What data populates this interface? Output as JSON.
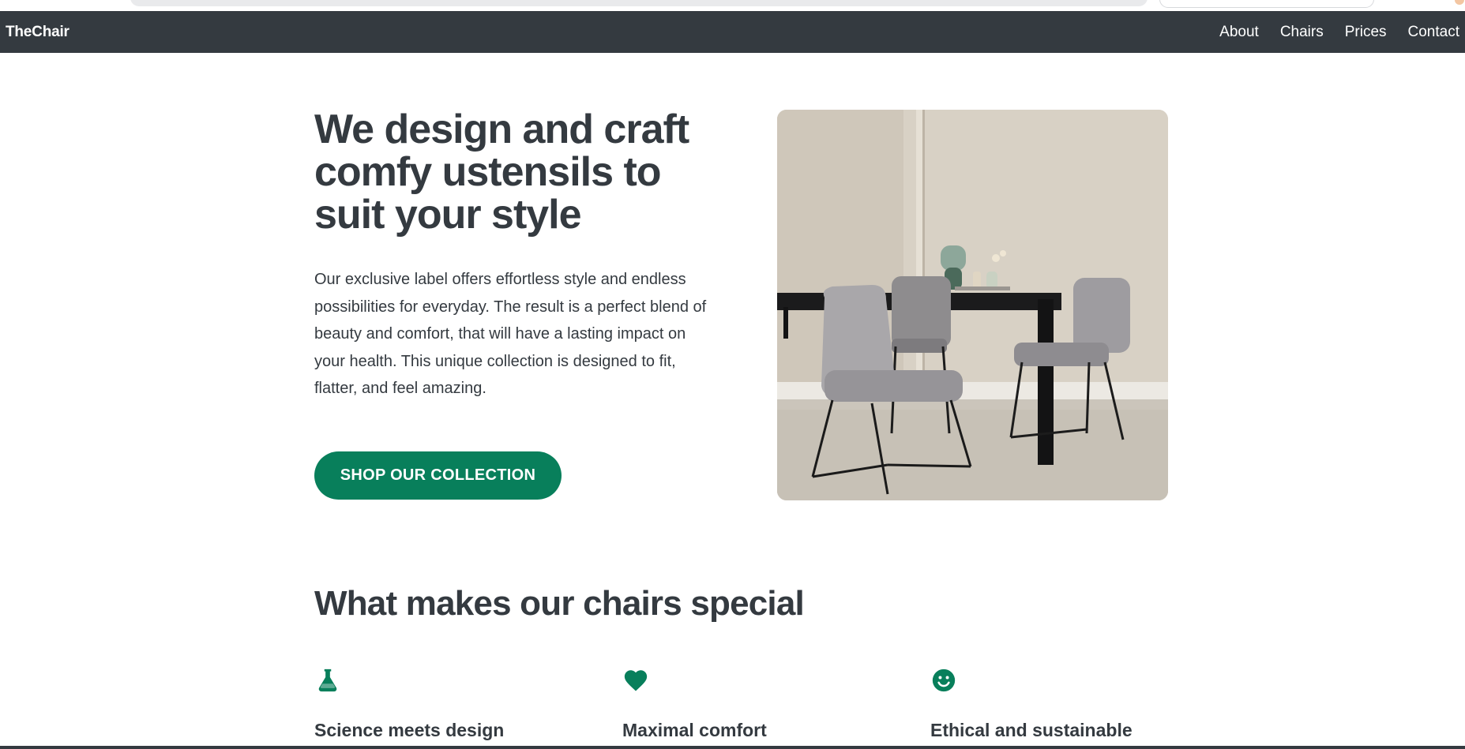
{
  "brand": "TheChair",
  "nav": {
    "items": [
      "About",
      "Chairs",
      "Prices",
      "Contact"
    ]
  },
  "hero": {
    "title": "We design and craft comfy ustensils to suit your style",
    "text": "Our exclusive label offers effortless style and endless possibilities for everyday. The result is a perfect blend of beauty and comfort, that will have a lasting impact on your health. This unique collection is designed to fit, flatter, and feel amazing.",
    "cta_label": "SHOP OUR COLLECTION",
    "image_alt": "Two grey chairs at a black dining table"
  },
  "features": {
    "title": "What makes our chairs special",
    "items": [
      {
        "icon": "flask-icon",
        "title": "Science meets design"
      },
      {
        "icon": "heart-icon",
        "title": "Maximal comfort"
      },
      {
        "icon": "smile-icon",
        "title": "Ethical and sustainable"
      }
    ]
  },
  "colors": {
    "primary": "#087f5b",
    "dark": "#343a40",
    "background": "#ffffff"
  }
}
